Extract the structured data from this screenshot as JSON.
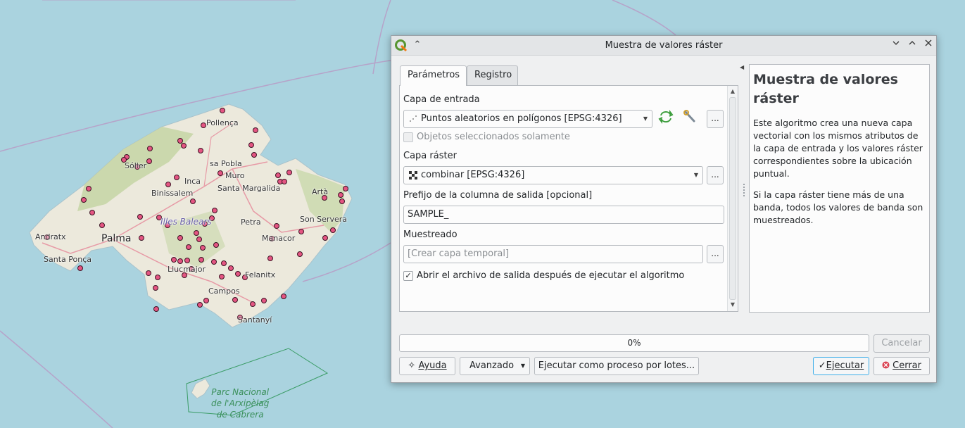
{
  "map": {
    "labels": {
      "soller": "Sóller",
      "pollenca": "Pollença",
      "sa_pobla": "sa Pobla",
      "muro": "Muro",
      "inca": "Inca",
      "santa_margalida": "Santa Margalida",
      "binissalem": "Binissalem",
      "arta": "Artà",
      "illes_balears": "Illes Balears",
      "petra": "Petra",
      "son_servera": "Son Servera",
      "andratx": "Andratx",
      "palma": "Palma",
      "manacor": "Manacor",
      "santa_ponca": "Santa Ponça",
      "llucmajor": "Llucmajor",
      "felanitx": "Felanitx",
      "campos": "Campos",
      "santanyi": "Santanyí",
      "parc_nacional": "Parc Nacional\nde l'Arxipèlag\nde Cabrera"
    },
    "colors": {
      "sea": "#aad3df",
      "land": "#f2efe9",
      "forest": "#c8d7ab",
      "points": "#e45582",
      "roads": "#e892a2"
    }
  },
  "dialog": {
    "title": "Muestra de valores ráster",
    "tabs": [
      "Parámetros",
      "Registro"
    ],
    "params": {
      "input_layer_label": "Capa de entrada",
      "input_layer_value": "Puntos aleatorios en polígonos [EPSG:4326]",
      "selected_only_label": "Objetos seleccionados solamente",
      "raster_layer_label": "Capa ráster",
      "raster_layer_value": "combinar [EPSG:4326]",
      "prefix_label": "Prefijo de la columna de salida [opcional]",
      "prefix_value": "SAMPLE_",
      "sampled_label": "Muestreado",
      "sampled_placeholder": "[Crear capa temporal]",
      "open_output_label": "Abrir el archivo de salida después de ejecutar el algoritmo",
      "ellipsis": "..."
    },
    "help": {
      "title": "Muestra de valores ráster",
      "p1": "Este algoritmo crea una nueva capa vectorial con los mismos atributos de la capa de entrada y los valores ráster correspondientes sobre la ubicación puntual.",
      "p2": "Si la capa ráster tiene más de una banda, todos los valores de banda son muestreados."
    },
    "progress_text": "0%",
    "buttons": {
      "cancel": "Cancelar",
      "help": "Ayuda",
      "advanced": "Avanzado",
      "batch": "Ejecutar como proceso por lotes...",
      "run": "Ejecutar",
      "close": "Cerrar"
    }
  }
}
